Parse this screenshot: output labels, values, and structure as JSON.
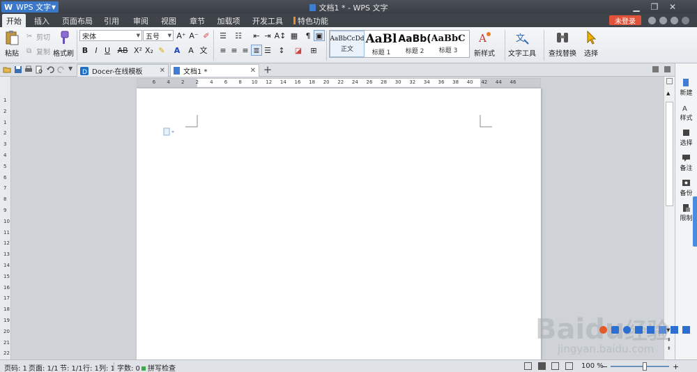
{
  "app": {
    "button_label": "WPS 文字",
    "window_title": "文档1 * - WPS 文字"
  },
  "ribbon_tabs": [
    {
      "label": "开始",
      "active": true
    },
    {
      "label": "插入"
    },
    {
      "label": "页面布局"
    },
    {
      "label": "引用"
    },
    {
      "label": "审阅"
    },
    {
      "label": "视图"
    },
    {
      "label": "章节"
    },
    {
      "label": "加载项"
    },
    {
      "label": "开发工具"
    },
    {
      "label": "特色功能"
    }
  ],
  "account": {
    "login_label": "未登录"
  },
  "clipboard": {
    "paste": "粘贴",
    "cut": "剪切",
    "copy": "复制",
    "format_painter": "格式刷"
  },
  "font": {
    "family_value": "宋体",
    "size_value": "五号"
  },
  "styles": [
    {
      "preview": "AaBbCcDd",
      "name": "正文"
    },
    {
      "preview": "AaBl",
      "name": "标题 1"
    },
    {
      "preview": "AaBb(",
      "name": "标题 2"
    },
    {
      "preview": "AaBbC",
      "name": "标题 3"
    }
  ],
  "ribbon_buttons": {
    "new_style": "新样式",
    "text_tools": "文字工具",
    "find_replace": "查找替换",
    "select": "选择"
  },
  "doc_tabs": [
    {
      "label": "Docer-在线模板"
    },
    {
      "label": "文档1 *"
    }
  ],
  "ruler": {
    "h_ticks": [
      "6",
      "4",
      "2",
      "2",
      "4",
      "6",
      "8",
      "10",
      "12",
      "14",
      "16",
      "18",
      "20",
      "22",
      "24",
      "26",
      "28",
      "30",
      "32",
      "34",
      "36",
      "38",
      "40",
      "42",
      "44",
      "46"
    ],
    "v_ticks": [
      "1",
      "2",
      "1",
      "2",
      "3",
      "4",
      "5",
      "6",
      "7",
      "8",
      "9",
      "10",
      "11",
      "12",
      "13",
      "14",
      "15",
      "16",
      "17",
      "18",
      "19",
      "20",
      "21",
      "22"
    ]
  },
  "right_panel": [
    {
      "label": "新建",
      "icon": "new-doc-icon"
    },
    {
      "label": "样式",
      "icon": "style-icon"
    },
    {
      "label": "选择",
      "icon": "select-icon"
    },
    {
      "label": "备注",
      "icon": "comment-icon"
    },
    {
      "label": "备份",
      "icon": "backup-icon"
    },
    {
      "label": "限制",
      "icon": "restrict-icon"
    }
  ],
  "status_bar": {
    "page_code": "页码: 1",
    "pages": "页面: 1/1",
    "section": "节: 1/1",
    "row": "行: 1",
    "col": "列: 1",
    "word_count": "字数: 0",
    "spell_check": "拼写检查",
    "zoom": "100 %"
  },
  "watermark": {
    "brand_main": "Bai",
    "brand_du": "du",
    "brand_cn": "经验",
    "url": "jingyan.baidu.com"
  },
  "colors": {
    "accent": "#3b78c9",
    "login": "#e0533a",
    "tab_active_bg": "#eef1f4",
    "chrome_dark": "#3f434a"
  }
}
